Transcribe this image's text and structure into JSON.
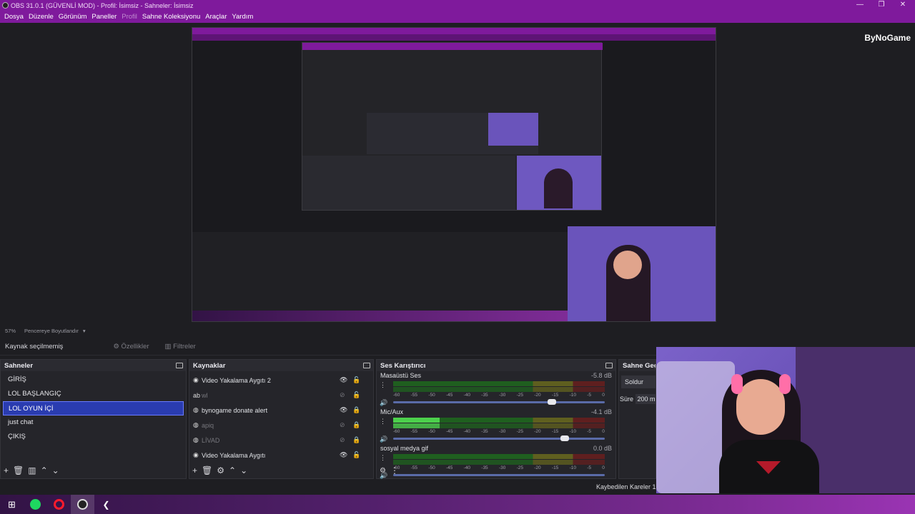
{
  "window": {
    "title": "OBS 31.0.1 (GÜVENLİ MOD) - Profil: İsimsiz - Sahneler: İsimsiz",
    "minimize": "—",
    "maximize": "❐",
    "close": "✕"
  },
  "menu": [
    "Dosya",
    "Düzenle",
    "Görünüm",
    "Paneller",
    "Profil",
    "Sahne Koleksiyonu",
    "Araçlar",
    "Yardım"
  ],
  "brand": "ByNoGame",
  "preview_status": {
    "zoom": "57%",
    "mode": "Pencereye Boyutlandır"
  },
  "source_bar": {
    "selection": "Kaynak seçilmemiş",
    "properties": "Özellikler",
    "filters": "Filtreler"
  },
  "scenes": {
    "title": "Sahneler",
    "items": [
      "GİRİŞ",
      "LOL BAŞLANGIÇ",
      "LOL OYUN İÇİ",
      "just chat",
      "ÇIKIŞ"
    ],
    "selected": "LOL OYUN İÇİ"
  },
  "sources": {
    "title": "Kaynaklar",
    "items": [
      {
        "name": "Video Yakalama Aygıtı 2",
        "visible": true
      },
      {
        "name": "wl",
        "visible": false
      },
      {
        "name": "bynogame donate alert",
        "visible": true
      },
      {
        "name": "apiq",
        "visible": false
      },
      {
        "name": "LİVAD",
        "visible": false
      },
      {
        "name": "Video Yakalama Aygıtı",
        "visible": true
      }
    ]
  },
  "mixer": {
    "title": "Ses Karıştırıcı",
    "channels": [
      {
        "name": "Masaüstü Ses",
        "db": "-5.8 dB",
        "level": 0.0,
        "volume": 0.75
      },
      {
        "name": "Mic/Aux",
        "db": "-4.1 dB",
        "level": 0.22,
        "volume": 0.81
      },
      {
        "name": "sosyal medya gif",
        "db": "0.0 dB",
        "level": 0.0,
        "volume": 0.0
      }
    ],
    "scale": [
      "-60",
      "-55",
      "-50",
      "-45",
      "-40",
      "-35",
      "-30",
      "-25",
      "-20",
      "-15",
      "-10",
      "-5",
      "0"
    ]
  },
  "transitions": {
    "title": "Sahne Geçiş",
    "type": "Soldur",
    "duration_label": "Süre",
    "duration": "200 m"
  },
  "status": {
    "lost_frames": "Kaybedilen Kareler 1"
  },
  "colors": {
    "accent": "#7f1a9c",
    "selection": "#2a3cb0"
  }
}
